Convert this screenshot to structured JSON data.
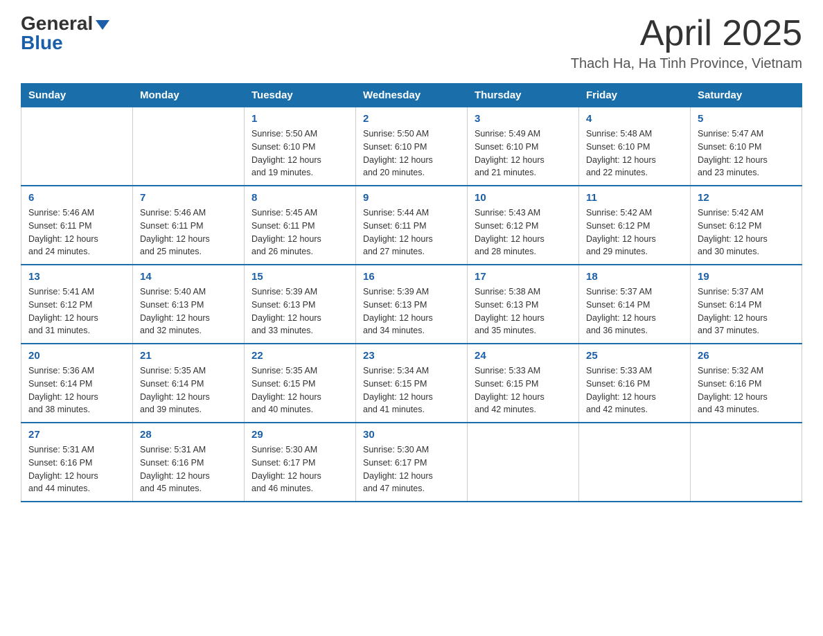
{
  "header": {
    "logo_general": "General",
    "logo_blue": "Blue",
    "main_title": "April 2025",
    "subtitle": "Thach Ha, Ha Tinh Province, Vietnam"
  },
  "calendar": {
    "days_of_week": [
      "Sunday",
      "Monday",
      "Tuesday",
      "Wednesday",
      "Thursday",
      "Friday",
      "Saturday"
    ],
    "weeks": [
      [
        {
          "day": "",
          "info": ""
        },
        {
          "day": "",
          "info": ""
        },
        {
          "day": "1",
          "info": "Sunrise: 5:50 AM\nSunset: 6:10 PM\nDaylight: 12 hours\nand 19 minutes."
        },
        {
          "day": "2",
          "info": "Sunrise: 5:50 AM\nSunset: 6:10 PM\nDaylight: 12 hours\nand 20 minutes."
        },
        {
          "day": "3",
          "info": "Sunrise: 5:49 AM\nSunset: 6:10 PM\nDaylight: 12 hours\nand 21 minutes."
        },
        {
          "day": "4",
          "info": "Sunrise: 5:48 AM\nSunset: 6:10 PM\nDaylight: 12 hours\nand 22 minutes."
        },
        {
          "day": "5",
          "info": "Sunrise: 5:47 AM\nSunset: 6:10 PM\nDaylight: 12 hours\nand 23 minutes."
        }
      ],
      [
        {
          "day": "6",
          "info": "Sunrise: 5:46 AM\nSunset: 6:11 PM\nDaylight: 12 hours\nand 24 minutes."
        },
        {
          "day": "7",
          "info": "Sunrise: 5:46 AM\nSunset: 6:11 PM\nDaylight: 12 hours\nand 25 minutes."
        },
        {
          "day": "8",
          "info": "Sunrise: 5:45 AM\nSunset: 6:11 PM\nDaylight: 12 hours\nand 26 minutes."
        },
        {
          "day": "9",
          "info": "Sunrise: 5:44 AM\nSunset: 6:11 PM\nDaylight: 12 hours\nand 27 minutes."
        },
        {
          "day": "10",
          "info": "Sunrise: 5:43 AM\nSunset: 6:12 PM\nDaylight: 12 hours\nand 28 minutes."
        },
        {
          "day": "11",
          "info": "Sunrise: 5:42 AM\nSunset: 6:12 PM\nDaylight: 12 hours\nand 29 minutes."
        },
        {
          "day": "12",
          "info": "Sunrise: 5:42 AM\nSunset: 6:12 PM\nDaylight: 12 hours\nand 30 minutes."
        }
      ],
      [
        {
          "day": "13",
          "info": "Sunrise: 5:41 AM\nSunset: 6:12 PM\nDaylight: 12 hours\nand 31 minutes."
        },
        {
          "day": "14",
          "info": "Sunrise: 5:40 AM\nSunset: 6:13 PM\nDaylight: 12 hours\nand 32 minutes."
        },
        {
          "day": "15",
          "info": "Sunrise: 5:39 AM\nSunset: 6:13 PM\nDaylight: 12 hours\nand 33 minutes."
        },
        {
          "day": "16",
          "info": "Sunrise: 5:39 AM\nSunset: 6:13 PM\nDaylight: 12 hours\nand 34 minutes."
        },
        {
          "day": "17",
          "info": "Sunrise: 5:38 AM\nSunset: 6:13 PM\nDaylight: 12 hours\nand 35 minutes."
        },
        {
          "day": "18",
          "info": "Sunrise: 5:37 AM\nSunset: 6:14 PM\nDaylight: 12 hours\nand 36 minutes."
        },
        {
          "day": "19",
          "info": "Sunrise: 5:37 AM\nSunset: 6:14 PM\nDaylight: 12 hours\nand 37 minutes."
        }
      ],
      [
        {
          "day": "20",
          "info": "Sunrise: 5:36 AM\nSunset: 6:14 PM\nDaylight: 12 hours\nand 38 minutes."
        },
        {
          "day": "21",
          "info": "Sunrise: 5:35 AM\nSunset: 6:14 PM\nDaylight: 12 hours\nand 39 minutes."
        },
        {
          "day": "22",
          "info": "Sunrise: 5:35 AM\nSunset: 6:15 PM\nDaylight: 12 hours\nand 40 minutes."
        },
        {
          "day": "23",
          "info": "Sunrise: 5:34 AM\nSunset: 6:15 PM\nDaylight: 12 hours\nand 41 minutes."
        },
        {
          "day": "24",
          "info": "Sunrise: 5:33 AM\nSunset: 6:15 PM\nDaylight: 12 hours\nand 42 minutes."
        },
        {
          "day": "25",
          "info": "Sunrise: 5:33 AM\nSunset: 6:16 PM\nDaylight: 12 hours\nand 42 minutes."
        },
        {
          "day": "26",
          "info": "Sunrise: 5:32 AM\nSunset: 6:16 PM\nDaylight: 12 hours\nand 43 minutes."
        }
      ],
      [
        {
          "day": "27",
          "info": "Sunrise: 5:31 AM\nSunset: 6:16 PM\nDaylight: 12 hours\nand 44 minutes."
        },
        {
          "day": "28",
          "info": "Sunrise: 5:31 AM\nSunset: 6:16 PM\nDaylight: 12 hours\nand 45 minutes."
        },
        {
          "day": "29",
          "info": "Sunrise: 5:30 AM\nSunset: 6:17 PM\nDaylight: 12 hours\nand 46 minutes."
        },
        {
          "day": "30",
          "info": "Sunrise: 5:30 AM\nSunset: 6:17 PM\nDaylight: 12 hours\nand 47 minutes."
        },
        {
          "day": "",
          "info": ""
        },
        {
          "day": "",
          "info": ""
        },
        {
          "day": "",
          "info": ""
        }
      ]
    ]
  }
}
